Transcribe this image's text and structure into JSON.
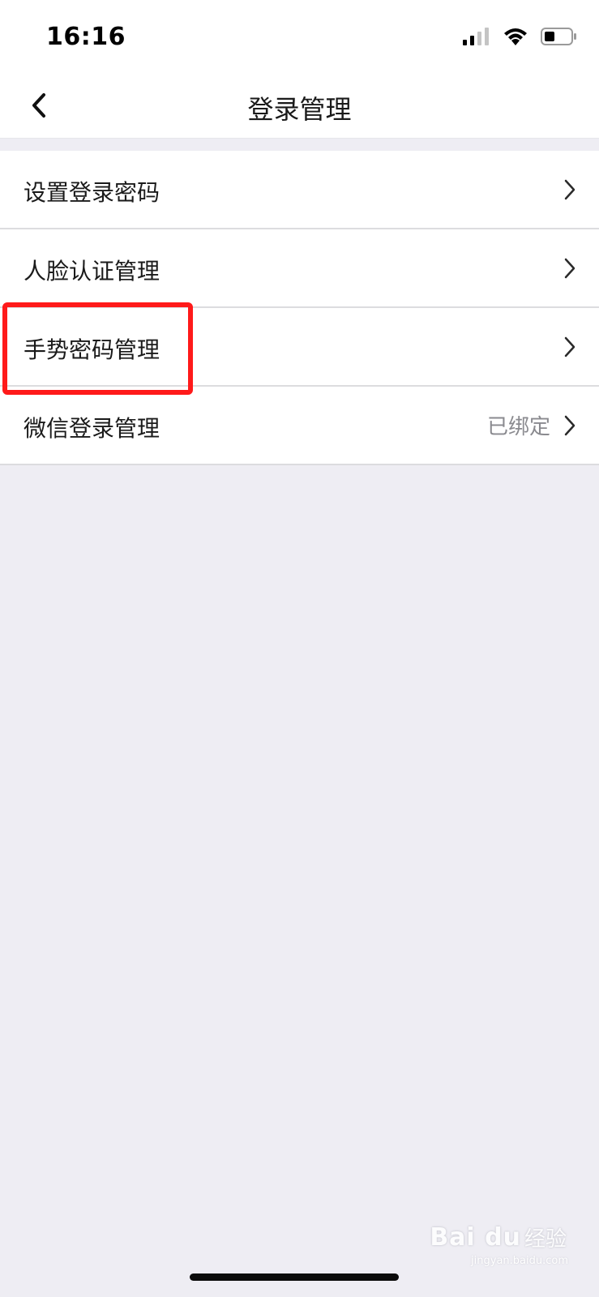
{
  "status_bar": {
    "time": "16:16",
    "icons": [
      "signal-icon",
      "wifi-icon",
      "battery-icon"
    ]
  },
  "nav": {
    "title": "登录管理",
    "back_icon": "chevron-left-icon"
  },
  "menu": {
    "items": [
      {
        "label": "设置登录密码",
        "value": ""
      },
      {
        "label": "人脸认证管理",
        "value": ""
      },
      {
        "label": "手势密码管理",
        "value": ""
      },
      {
        "label": "微信登录管理",
        "value": "已绑定"
      }
    ]
  },
  "annotation": {
    "highlight_color": "#ff1a1a",
    "highlighted_item": "手势密码管理"
  },
  "watermark": {
    "logo": "Bai du",
    "text": "经验",
    "sub": "jingyan.baidu.com"
  },
  "colors": {
    "background": "#eeedf3",
    "card": "#ffffff",
    "value_text": "#8a8a8f"
  }
}
